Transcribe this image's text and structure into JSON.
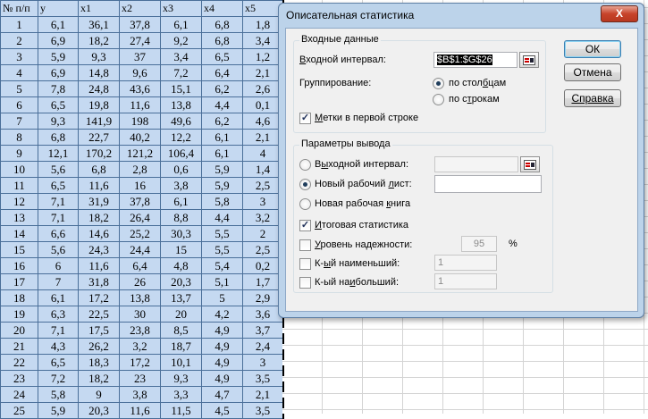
{
  "sheet": {
    "headers": [
      "№ п/п",
      "y",
      "x1",
      "x2",
      "x3",
      "x4",
      "x5"
    ],
    "rows": [
      [
        "1",
        "6,1",
        "36,1",
        "37,8",
        "6,1",
        "6,8",
        "1,8"
      ],
      [
        "2",
        "6,9",
        "18,2",
        "27,4",
        "9,2",
        "6,8",
        "3,4"
      ],
      [
        "3",
        "5,9",
        "9,3",
        "37",
        "3,4",
        "6,5",
        "1,2"
      ],
      [
        "4",
        "6,9",
        "14,8",
        "9,6",
        "7,2",
        "6,4",
        "2,1"
      ],
      [
        "5",
        "7,8",
        "24,8",
        "43,6",
        "15,1",
        "6,2",
        "2,6"
      ],
      [
        "6",
        "6,5",
        "19,8",
        "11,6",
        "13,8",
        "4,4",
        "0,1"
      ],
      [
        "7",
        "9,3",
        "141,9",
        "198",
        "49,6",
        "6,2",
        "4,6"
      ],
      [
        "8",
        "6,8",
        "22,7",
        "40,2",
        "12,2",
        "6,1",
        "2,1"
      ],
      [
        "9",
        "12,1",
        "170,2",
        "121,2",
        "106,4",
        "6,1",
        "4"
      ],
      [
        "10",
        "5,6",
        "6,8",
        "2,8",
        "0,6",
        "5,9",
        "1,4"
      ],
      [
        "11",
        "6,5",
        "11,6",
        "16",
        "3,8",
        "5,9",
        "2,5"
      ],
      [
        "12",
        "7,1",
        "31,9",
        "37,8",
        "6,1",
        "5,8",
        "3"
      ],
      [
        "13",
        "7,1",
        "18,2",
        "26,4",
        "8,8",
        "4,4",
        "3,2"
      ],
      [
        "14",
        "6,6",
        "14,6",
        "25,2",
        "30,3",
        "5,5",
        "2"
      ],
      [
        "15",
        "5,6",
        "24,3",
        "24,4",
        "15",
        "5,5",
        "2,5"
      ],
      [
        "16",
        "6",
        "11,6",
        "6,4",
        "4,8",
        "5,4",
        "0,2"
      ],
      [
        "17",
        "7",
        "31,8",
        "26",
        "20,3",
        "5,1",
        "1,7"
      ],
      [
        "18",
        "6,1",
        "17,2",
        "13,8",
        "13,7",
        "5",
        "2,9"
      ],
      [
        "19",
        "6,3",
        "22,5",
        "30",
        "20",
        "4,2",
        "3,6"
      ],
      [
        "20",
        "7,1",
        "17,5",
        "23,8",
        "8,5",
        "4,9",
        "3,7"
      ],
      [
        "21",
        "4,3",
        "26,2",
        "3,2",
        "18,7",
        "4,9",
        "2,4"
      ],
      [
        "22",
        "6,5",
        "18,3",
        "17,2",
        "10,1",
        "4,9",
        "3"
      ],
      [
        "23",
        "7,2",
        "18,2",
        "23",
        "9,3",
        "4,9",
        "3,5"
      ],
      [
        "24",
        "5,8",
        "9",
        "3,8",
        "3,3",
        "4,7",
        "2,1"
      ],
      [
        "25",
        "5,9",
        "20,3",
        "11,6",
        "11,5",
        "4,5",
        "3,5"
      ]
    ]
  },
  "dialog": {
    "title": "Описательная статистика",
    "close_label": "X",
    "input_group": {
      "legend": "Входные данные",
      "range_label_pre": "",
      "range_label_ul": "В",
      "range_label_post": "ходной интервал:",
      "range_value": "$B$1:$G$26",
      "grouping_label": "Группирование:",
      "by_columns_pre": "по стол",
      "by_columns_ul": "б",
      "by_columns_post": "цам",
      "by_rows_pre": "по с",
      "by_rows_ul": "т",
      "by_rows_post": "рокам",
      "labels_pre": "",
      "labels_ul": "М",
      "labels_post": "етки в первой строке"
    },
    "output_group": {
      "legend": "Параметры вывода",
      "output_range_pre": "В",
      "output_range_ul": "ы",
      "output_range_post": "ходной интервал:",
      "new_sheet_pre": "Новый рабочий ",
      "new_sheet_ul": "л",
      "new_sheet_post": "ист:",
      "new_book_pre": "Новая рабочая ",
      "new_book_ul": "к",
      "new_book_post": "нига",
      "summary_pre": "",
      "summary_ul": "И",
      "summary_post": "тоговая статистика",
      "confidence_pre": "",
      "confidence_ul": "У",
      "confidence_post": "ровень надежности:",
      "confidence_value": "95",
      "percent": "%",
      "kth_smallest_pre": "К-",
      "kth_smallest_ul": "ы",
      "kth_smallest_post": "й наименьший:",
      "kth_smallest_value": "1",
      "kth_largest_pre": "К-ый на",
      "kth_largest_ul": "и",
      "kth_largest_post": "больший:",
      "kth_largest_value": "1"
    },
    "buttons": {
      "ok": "ОК",
      "cancel": "Отмена",
      "help": "Справка"
    }
  }
}
